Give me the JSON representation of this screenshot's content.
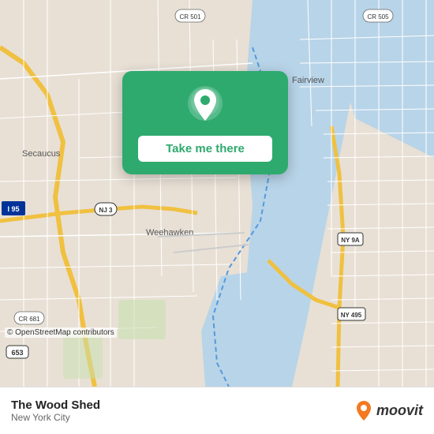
{
  "map": {
    "attribution": "© OpenStreetMap contributors"
  },
  "popup": {
    "button_label": "Take me there",
    "pin_icon": "location-pin"
  },
  "bottom_bar": {
    "location_name": "The Wood Shed",
    "location_city": "New York City",
    "brand": "moovit"
  }
}
